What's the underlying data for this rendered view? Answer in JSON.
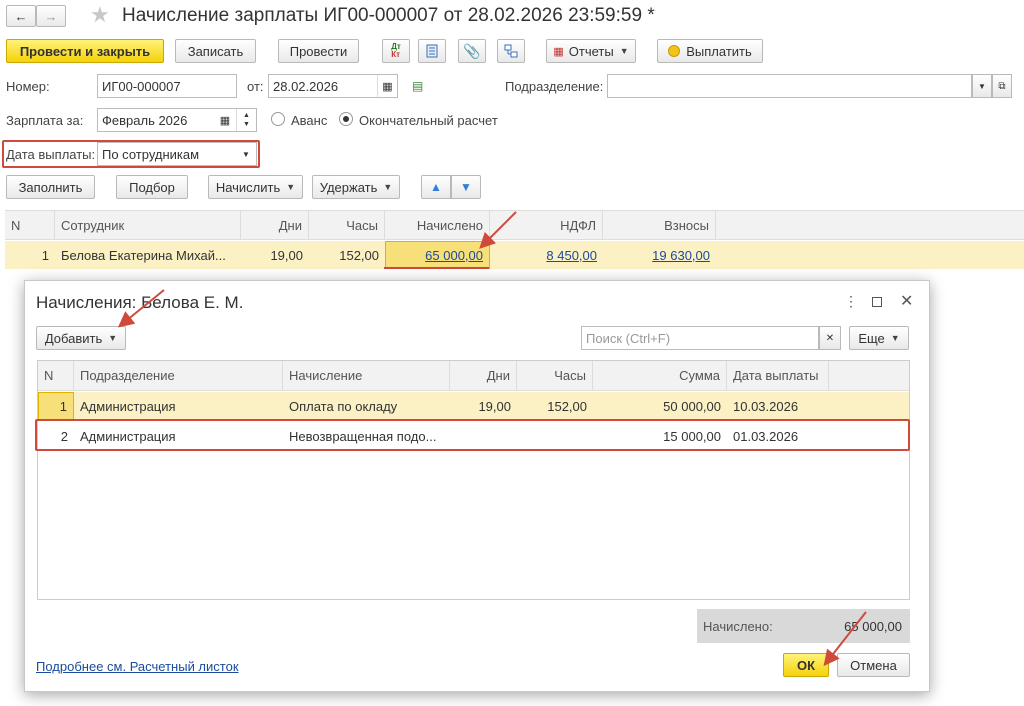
{
  "window": {
    "title": "Начисление зарплаты ИГ00-000007 от 28.02.2026 23:59:59 *"
  },
  "toolbar": {
    "post_close": "Провести и закрыть",
    "save": "Записать",
    "post": "Провести",
    "dt_kt_top": "Дт",
    "dt_kt_bottom": "Кт",
    "reports": "Отчеты",
    "pay": "Выплатить"
  },
  "form": {
    "number_label": "Номер:",
    "number_value": "ИГ00-000007",
    "from_label": "от:",
    "date_value": "28.02.2026",
    "department_label": "Подразделение:",
    "department_value": "",
    "salary_for_label": "Зарплата за:",
    "salary_for_value": "Февраль 2026",
    "advance_label": "Аванс",
    "final_label": "Окончательный расчет",
    "payment_date_label": "Дата выплаты:",
    "payment_date_value": "По сотрудникам"
  },
  "table_toolbar": {
    "fill": "Заполнить",
    "select": "Подбор",
    "accrue": "Начислить",
    "withhold": "Удержать"
  },
  "main_table": {
    "headers": [
      "N",
      "Сотрудник",
      "Дни",
      "Часы",
      "Начислено",
      "НДФЛ",
      "Взносы"
    ],
    "rows": [
      {
        "n": "1",
        "employee": "Белова Екатерина Михай...",
        "days": "19,00",
        "hours": "152,00",
        "accrued": "65 000,00",
        "ndfl": "8 450,00",
        "contrib": "19 630,00"
      }
    ]
  },
  "dialog": {
    "title": "Начисления: Белова Е. М.",
    "add": "Добавить",
    "search_placeholder": "Поиск (Ctrl+F)",
    "more": "Еще",
    "headers": [
      "N",
      "Подразделение",
      "Начисление",
      "Дни",
      "Часы",
      "Сумма",
      "Дата выплаты"
    ],
    "rows": [
      {
        "n": "1",
        "dept": "Администрация",
        "accrual": "Оплата по окладу",
        "days": "19,00",
        "hours": "152,00",
        "sum": "50 000,00",
        "pay_date": "10.03.2026"
      },
      {
        "n": "2",
        "dept": "Администрация",
        "accrual": "Невозвращенная подо...",
        "days": "",
        "hours": "",
        "sum": "15 000,00",
        "pay_date": "01.03.2026"
      }
    ],
    "total_label": "Начислено:",
    "total_value": "65 000,00",
    "payslip_link": "Подробнее см. Расчетный листок",
    "ok": "ОК",
    "cancel": "Отмена"
  },
  "colors": {
    "accent_yellow": "#f5d20a",
    "row_highlight": "#fbf1c4",
    "annotation_red": "#d04a3c",
    "link_blue": "#1a4b9c"
  }
}
